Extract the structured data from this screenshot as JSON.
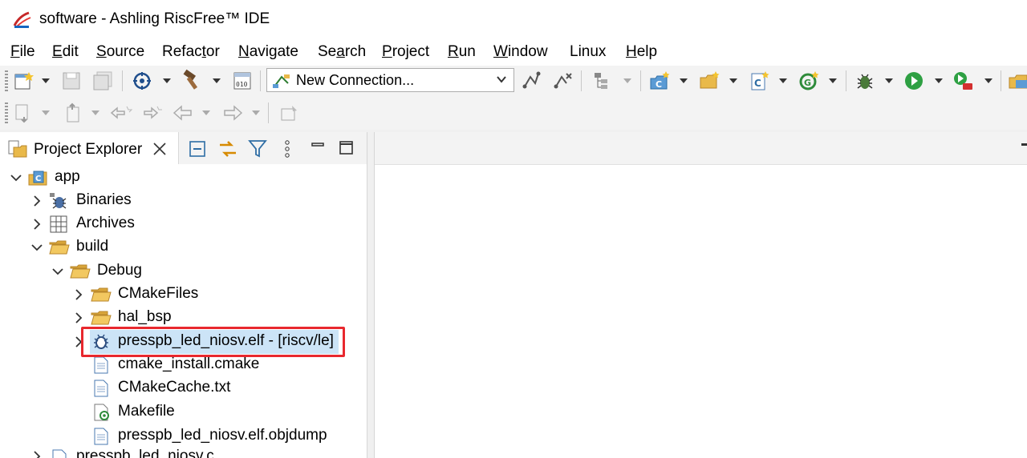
{
  "window": {
    "title": "software - Ashling RiscFree™ IDE"
  },
  "menu": [
    {
      "mnemonic": "F",
      "rest": "ile"
    },
    {
      "mnemonic": "E",
      "rest": "dit"
    },
    {
      "mnemonic": "S",
      "rest": "ource"
    },
    {
      "pre": "Refac",
      "mnemonic": "t",
      "rest": "or"
    },
    {
      "mnemonic": "N",
      "rest": "avigate"
    },
    {
      "pre": "Se",
      "mnemonic": "a",
      "rest": "rch"
    },
    {
      "mnemonic": "P",
      "rest": "roject"
    },
    {
      "mnemonic": "R",
      "rest": "un"
    },
    {
      "mnemonic": "W",
      "rest": "indow"
    },
    {
      "label": "Linux"
    },
    {
      "mnemonic": "H",
      "rest": "elp"
    }
  ],
  "toolbar": {
    "connection": {
      "value": "New Connection...",
      "icon": "connection-icon"
    },
    "icons": [
      "new-icon",
      "save-icon",
      "save-all-icon",
      "debug-settings-icon",
      "build-hammer-icon",
      "binary-icon",
      "connect-icon",
      "disconnect-icon",
      "tree-icon",
      "new-class-icon",
      "new-folder-icon",
      "new-source-icon",
      "new-refresh-icon",
      "debug-bug-icon",
      "run-icon",
      "external-tool-icon",
      "perspective-icon",
      "next-annotation-icon",
      "prev-annotation-icon",
      "last-edit-icon",
      "next-edit-icon",
      "back-icon",
      "forward-icon",
      "pin-icon"
    ]
  },
  "project_explorer": {
    "title": "Project Explorer",
    "tree": [
      {
        "label": "app",
        "icon": "c-project-icon",
        "expanded": true
      },
      {
        "label": "Binaries",
        "icon": "binaries-icon",
        "expanded": false
      },
      {
        "label": "Archives",
        "icon": "archives-icon",
        "expanded": false
      },
      {
        "label": "build",
        "icon": "folder-open-icon",
        "expanded": true
      },
      {
        "label": "Debug",
        "icon": "folder-open-icon",
        "expanded": true
      },
      {
        "label": "CMakeFiles",
        "icon": "folder-icon",
        "expanded": false
      },
      {
        "label": "hal_bsp",
        "icon": "folder-icon",
        "expanded": false
      },
      {
        "label": "presspb_led_niosv.elf - [riscv/le]",
        "icon": "elf-binary-icon",
        "expanded": false,
        "selected": true
      },
      {
        "label": "cmake_install.cmake",
        "icon": "file-icon"
      },
      {
        "label": "CMakeCache.txt",
        "icon": "file-icon"
      },
      {
        "label": "Makefile",
        "icon": "makefile-icon"
      },
      {
        "label": "presspb_led_niosv.elf.objdump",
        "icon": "file-icon"
      },
      {
        "label": "presspb_led_niosv.c",
        "icon": "c-file-icon"
      }
    ]
  },
  "colors": {
    "highlight": "#e8282e",
    "selection": "#cce4f7",
    "folder": "#e9b94a"
  }
}
